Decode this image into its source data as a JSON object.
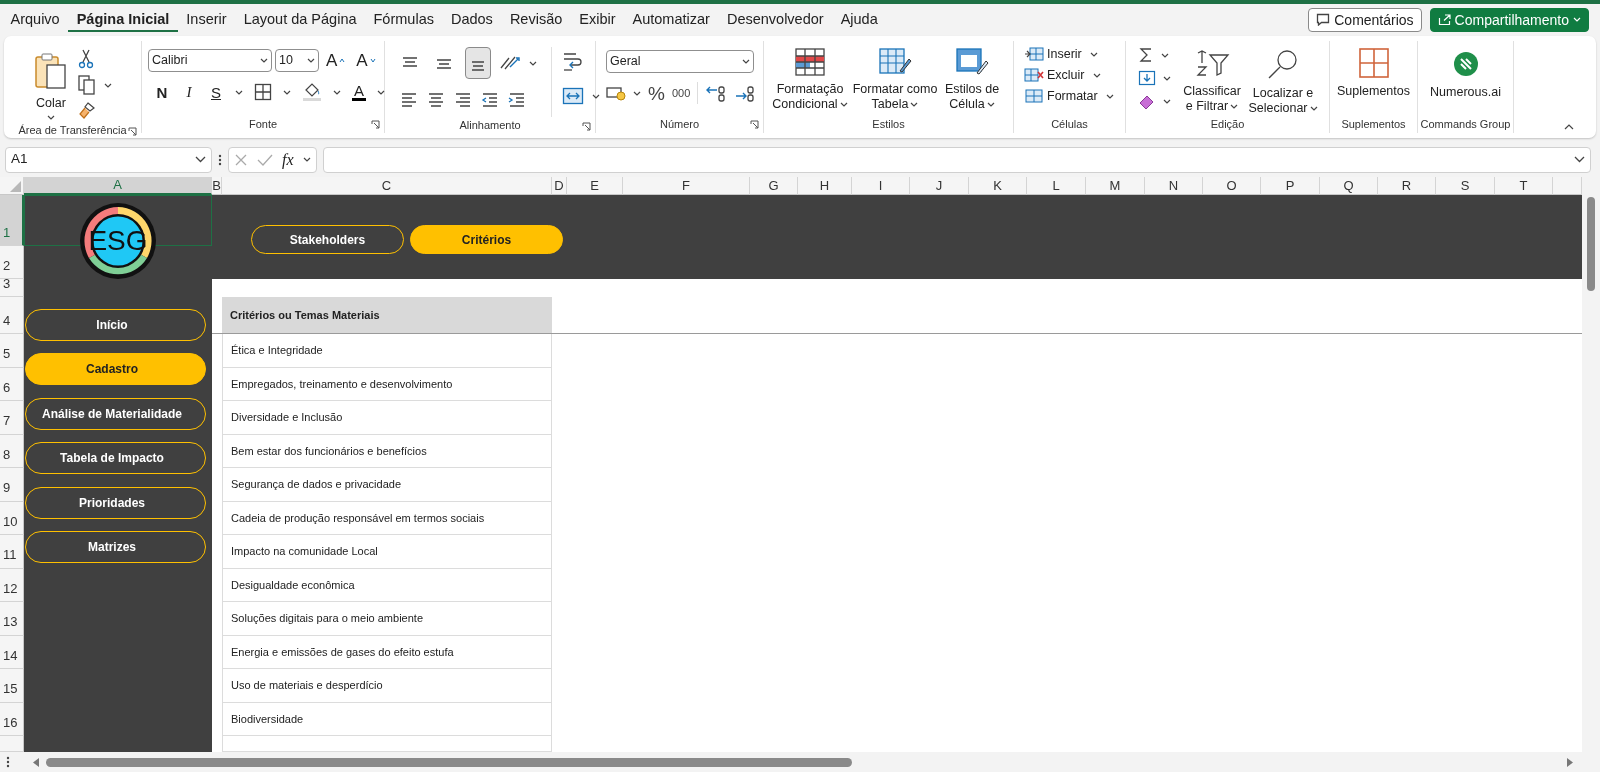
{
  "menu_tabs": [
    {
      "label": "Arquivo",
      "selected": false
    },
    {
      "label": "Página Inicial",
      "selected": true
    },
    {
      "label": "Inserir",
      "selected": false
    },
    {
      "label": "Layout da Página",
      "selected": false
    },
    {
      "label": "Fórmulas",
      "selected": false
    },
    {
      "label": "Dados",
      "selected": false
    },
    {
      "label": "Revisão",
      "selected": false
    },
    {
      "label": "Exibir",
      "selected": false
    },
    {
      "label": "Automatizar",
      "selected": false
    },
    {
      "label": "Desenvolvedor",
      "selected": false
    },
    {
      "label": "Ajuda",
      "selected": false
    }
  ],
  "header_buttons": [
    {
      "label": "Comentários",
      "kind": "comments"
    },
    {
      "label": "Compartilhamento",
      "kind": "share"
    }
  ],
  "ribbon": [
    {
      "kind": "clipboard",
      "label": "Área de Transferência",
      "buttons": [
        "Colar"
      ]
    },
    {
      "kind": "font",
      "label": "Fonte",
      "font": "Calibri",
      "size": "10",
      "size_buttons": [
        "A",
        "A"
      ],
      "style_buttons": [
        "N",
        "I",
        "S"
      ],
      "color_button": "A"
    },
    {
      "kind": "alignment",
      "label": "Alinhamento",
      "vertical": [
        {
          "selected": false
        },
        {
          "selected": false
        },
        {
          "selected": true
        }
      ]
    },
    {
      "kind": "number",
      "label": "Número",
      "format": "Geral",
      "buttons": [
        "%",
        "000"
      ]
    },
    {
      "kind": "styles",
      "label": "Estilos",
      "buttons": [
        "Formatação Condicional",
        "Formatar como Tabela",
        "Estilos de Célula"
      ]
    },
    {
      "kind": "cells",
      "label": "Células",
      "buttons": [
        "Inserir",
        "Excluir",
        "Formatar"
      ]
    },
    {
      "kind": "editing",
      "label": "Edição",
      "buttons": [
        "Classificar e Filtrar",
        "Localizar e Selecionar"
      ]
    },
    {
      "kind": "addins",
      "label": "Suplementos",
      "buttons": [
        "Suplementos"
      ]
    },
    {
      "kind": "commands",
      "label": "Commands Group",
      "buttons": [
        "Numerous.ai"
      ]
    }
  ],
  "formula_bar": {
    "name_box": "A1",
    "function_label": "fx"
  },
  "columns": [
    {
      "label": "A",
      "selected": true
    },
    {
      "label": "B",
      "selected": false
    },
    {
      "label": "C",
      "selected": false
    },
    {
      "label": "D",
      "selected": false
    },
    {
      "label": "E",
      "selected": false
    },
    {
      "label": "F",
      "selected": false
    },
    {
      "label": "G",
      "selected": false
    },
    {
      "label": "H",
      "selected": false
    },
    {
      "label": "I",
      "selected": false
    },
    {
      "label": "J",
      "selected": false
    },
    {
      "label": "K",
      "selected": false
    },
    {
      "label": "L",
      "selected": false
    },
    {
      "label": "M",
      "selected": false
    },
    {
      "label": "N",
      "selected": false
    },
    {
      "label": "O",
      "selected": false
    },
    {
      "label": "P",
      "selected": false
    },
    {
      "label": "Q",
      "selected": false
    },
    {
      "label": "R",
      "selected": false
    },
    {
      "label": "S",
      "selected": false
    },
    {
      "label": "T",
      "selected": false
    }
  ],
  "rows": [
    {
      "label": "1",
      "selected": true
    },
    {
      "label": "2",
      "selected": false
    },
    {
      "label": "3",
      "selected": false
    },
    {
      "label": "4",
      "selected": false
    },
    {
      "label": "5",
      "selected": false
    },
    {
      "label": "6",
      "selected": false
    },
    {
      "label": "7",
      "selected": false
    },
    {
      "label": "8",
      "selected": false
    },
    {
      "label": "9",
      "selected": false
    },
    {
      "label": "10",
      "selected": false
    },
    {
      "label": "11",
      "selected": false
    },
    {
      "label": "12",
      "selected": false
    },
    {
      "label": "13",
      "selected": false
    },
    {
      "label": "14",
      "selected": false
    },
    {
      "label": "15",
      "selected": false
    },
    {
      "label": "16",
      "selected": false
    }
  ],
  "sheet": {
    "logo": "ESG",
    "nav": [
      {
        "label": "Início",
        "selected": false
      },
      {
        "label": "Cadastro",
        "selected": true
      },
      {
        "label": "Análise de Materialidade",
        "selected": false
      },
      {
        "label": "Tabela de Impacto",
        "selected": false
      },
      {
        "label": "Prioridades",
        "selected": false
      },
      {
        "label": "Matrizes",
        "selected": false
      }
    ],
    "tabs": [
      {
        "label": "Stakeholders",
        "selected": false
      },
      {
        "label": "Critérios",
        "selected": true
      }
    ],
    "table": {
      "header": "Critérios ou Temas Materiais",
      "rows": [
        "Ética e Integridade",
        "Empregados, treinamento e desenvolvimento",
        "Diversidade e Inclusão",
        "Bem estar dos funcionários e benefícios",
        "Segurança de dados e privacidade",
        "Cadeia de produção responsável em termos sociais",
        "Impacto na comunidade Local",
        "Desigualdade econômica",
        "Soluções digitais para o meio ambiente",
        "Energia e emissões de gases do efeito estufa",
        "Uso de materiais e desperdício",
        "Biodiversidade"
      ]
    }
  }
}
